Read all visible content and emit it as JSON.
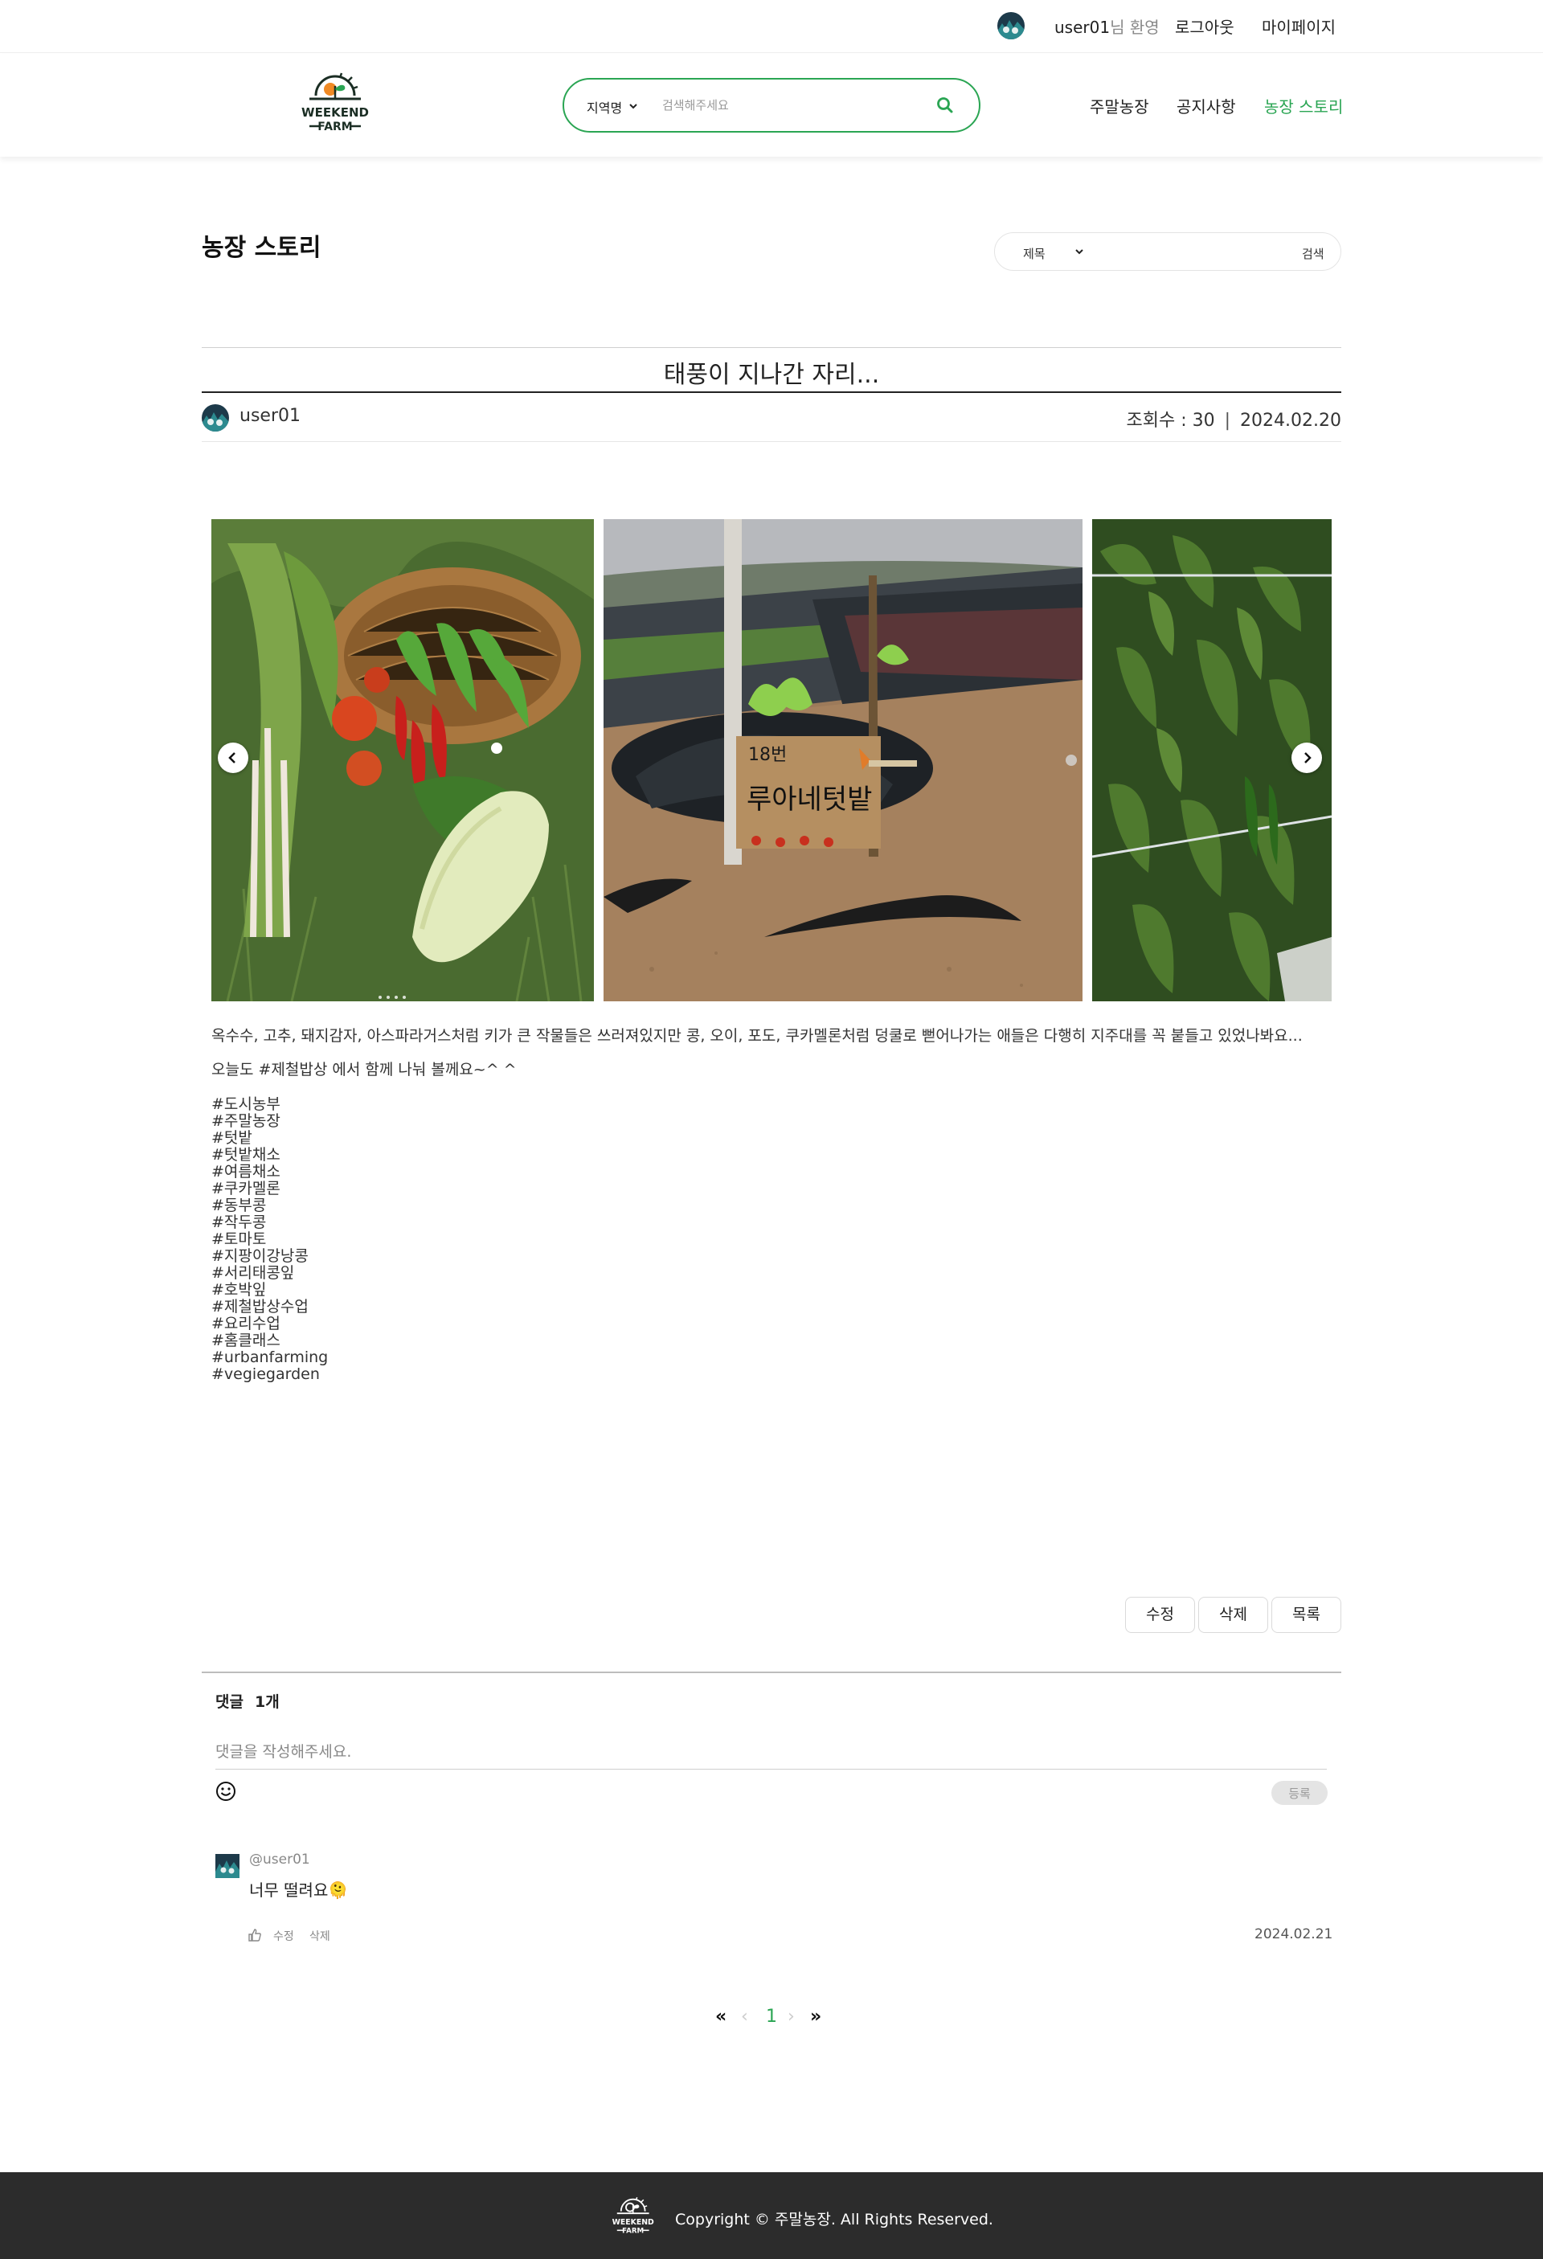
{
  "topbar": {
    "username": "user01",
    "greeting_suffix": "님 환영",
    "logout": "로그아웃",
    "mypage": "마이페이지"
  },
  "header": {
    "logo_text": [
      "WEEKEND",
      "FARM"
    ],
    "search": {
      "region_label": "지역명",
      "placeholder": "검색해주세요"
    },
    "nav": [
      "주말농장",
      "공지사항",
      "농장 스토리"
    ],
    "active_nav": "농장 스토리",
    "accent_color": "#2aa553"
  },
  "board": {
    "title": "농장 스토리",
    "search_field": "제목",
    "search_button": "검색"
  },
  "post": {
    "title": "태풍이 지나간 자리...",
    "author": "user01",
    "views_label": "조회수 : 30",
    "date": "2024.02.20",
    "photo_sign_text": [
      "18번",
      "루아네텃밭"
    ],
    "paragraph1": "옥수수, 고추, 돼지감자, 아스파라거스처럼 키가 큰 작물들은 쓰러져있지만 콩, 오이, 포도, 쿠카멜론처럼 덩쿨로 뻗어나가는 애들은 다행히 지주대를 꼭 붙들고 있었나봐요...",
    "paragraph2": "오늘도 #제철밥상 에서 함께 나눠 볼께요~^ ^",
    "tags": [
      "#도시농부",
      "#주말농장",
      "#텃밭",
      "#텃밭채소",
      "#여름채소",
      "#쿠카멜론",
      "#동부콩",
      "#작두콩",
      "#토마토",
      "#지팡이강낭콩",
      "#서리태콩잎",
      "#호박잎",
      "#제철밥상수업",
      "#요리수업",
      "#홈클래스",
      "#urbanfarming",
      "#vegiegarden"
    ]
  },
  "actions": {
    "edit": "수정",
    "delete": "삭제",
    "list": "목록"
  },
  "comments": {
    "label": "댓글",
    "count": "1개",
    "placeholder": "댓글을 작성해주세요.",
    "submit": "등록",
    "items": [
      {
        "user": "@user01",
        "text": "너무 떨려요🫠",
        "edit": "수정",
        "delete": "삭제",
        "date": "2024.02.21"
      }
    ]
  },
  "pagination": {
    "first": "«",
    "prev": "‹",
    "current": "1",
    "next": "›",
    "last": "»"
  },
  "footer": {
    "copyright": "Copyright © 주말농장. All Rights Reserved."
  }
}
